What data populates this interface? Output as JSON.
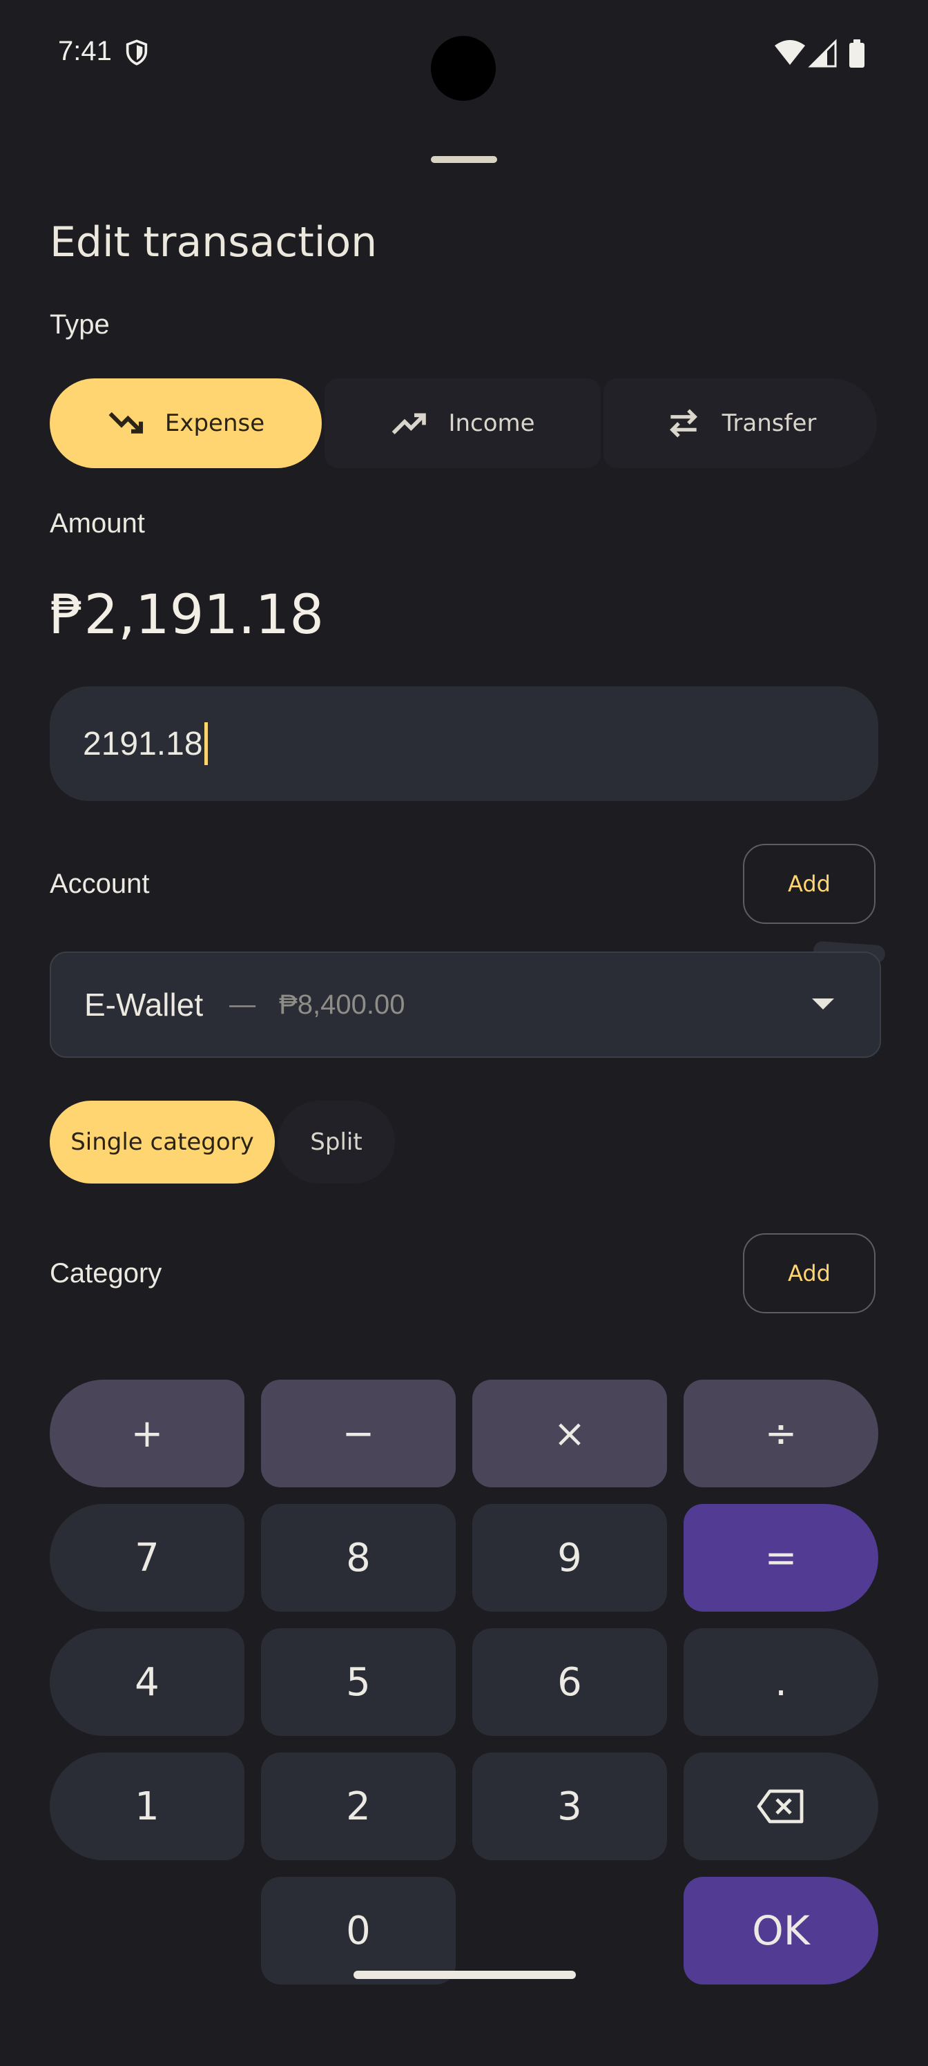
{
  "status_bar": {
    "time": "7:41"
  },
  "sheet": {
    "title": "Edit transaction",
    "type_label": "Type",
    "types": [
      {
        "label": "Expense",
        "icon": "trending-down-icon",
        "selected": true
      },
      {
        "label": "Income",
        "icon": "trending-up-icon",
        "selected": false
      },
      {
        "label": "Transfer",
        "icon": "swap-arrows-icon",
        "selected": false
      }
    ],
    "amount_label": "Amount",
    "amount_display": "₱2,191.18",
    "amount_input_value": "2191.18",
    "account_label": "Account",
    "account_add": "Add",
    "account": {
      "name": "E-Wallet",
      "separator": "—",
      "balance": "₱8,400.00"
    },
    "category_modes": [
      {
        "label": "Single category",
        "selected": true
      },
      {
        "label": "Split",
        "selected": false
      }
    ],
    "category_label": "Category",
    "category_add": "Add"
  },
  "keypad": {
    "plus": "+",
    "minus": "−",
    "multiply": "×",
    "divide": "÷",
    "seven": "7",
    "eight": "8",
    "nine": "9",
    "equals": "=",
    "four": "4",
    "five": "5",
    "six": "6",
    "dot": ".",
    "one": "1",
    "two": "2",
    "three": "3",
    "zero": "0",
    "ok": "OK"
  },
  "colors": {
    "accent": "#ffd572",
    "purple": "#523c93",
    "background": "#1d1c21",
    "field": "#2a2d35"
  }
}
